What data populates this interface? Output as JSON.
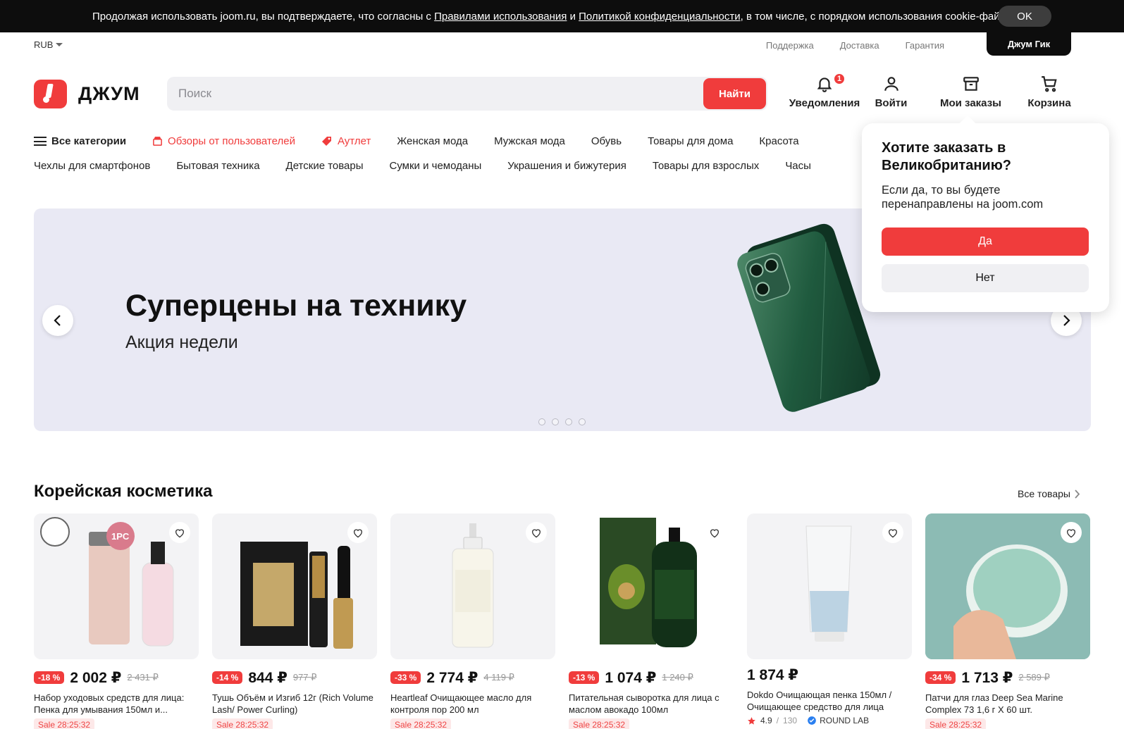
{
  "cookie": {
    "text_before": "Продолжая использовать joom.ru, вы подтверждаете, что согласны с ",
    "link1": "Правилами использования",
    "and": " и ",
    "link2": "Политикой конфиденциальности",
    "text_after": ", в том числе, с порядком использования cookie-файлов.",
    "ok": "OK"
  },
  "top": {
    "currency": "RUB",
    "links": [
      "Поддержка",
      "Доставка",
      "Гарантия"
    ],
    "geek": "Джум Гик"
  },
  "header": {
    "logo_text": "ДЖУМ",
    "search_placeholder": "Поиск",
    "search_button": "Найти",
    "actions": {
      "notifications": "Уведомления",
      "notifications_count": "1",
      "login": "Войти",
      "orders": "Мои заказы",
      "cart": "Корзина"
    }
  },
  "categories": {
    "all": "Все категории",
    "reviews": "Обзоры от пользователей",
    "outlet": "Аутлет",
    "row1": [
      "Женская мода",
      "Мужская мода",
      "Обувь",
      "Товары для дома",
      "Красота"
    ],
    "row2": [
      "Чехлы для смартфонов",
      "Бытовая техника",
      "Детские товары",
      "Сумки и чемоданы",
      "Украшения и бижутерия",
      "Товары для взрослых",
      "Часы"
    ]
  },
  "banner": {
    "title": "Суперцены на технику",
    "subtitle": "Акция недели"
  },
  "popup": {
    "title": "Хотите заказать в Великобританию?",
    "text": "Если да, то вы будете перенаправлены на joom.com",
    "yes": "Да",
    "no": "Нет"
  },
  "section": {
    "title": "Корейская косметика",
    "all": "Все товары"
  },
  "products": [
    {
      "discount": "-18 %",
      "price": "2 002 ₽",
      "old": "2 431 ₽",
      "name": "Набор уходовых средств для лица: Пенка для умывания 150мл и...",
      "sale": "Sale 28:25:32"
    },
    {
      "discount": "-14 %",
      "price": "844 ₽",
      "old": "977 ₽",
      "name": "Тушь Объём и Изгиб 12г (Rich Volume Lash/ Power Curling)",
      "sale": "Sale 28:25:32"
    },
    {
      "discount": "-33 %",
      "price": "2 774 ₽",
      "old": "4 119 ₽",
      "name": "Heartleaf Очищающее масло для контроля пор 200 мл",
      "sale": "Sale 28:25:32"
    },
    {
      "discount": "-13 %",
      "price": "1 074 ₽",
      "old": "1 240 ₽",
      "name": "Питательная сыворотка для лица с маслом авокадо 100мл",
      "sale": "Sale 28:25:32"
    },
    {
      "discount": "",
      "price": "1 874 ₽",
      "old": "",
      "name": "Dokdo Очищающая пенка 150мл / Очищающее средство для лица",
      "rating": "4.9",
      "reviews": "130",
      "store": "ROUND LAB"
    },
    {
      "discount": "-34 %",
      "price": "1 713 ₽",
      "old": "2 589 ₽",
      "name": "Патчи для глаз Deep Sea Marine Complex 73 1,6 г X 60 шт.",
      "sale": "Sale 28:25:32"
    }
  ]
}
